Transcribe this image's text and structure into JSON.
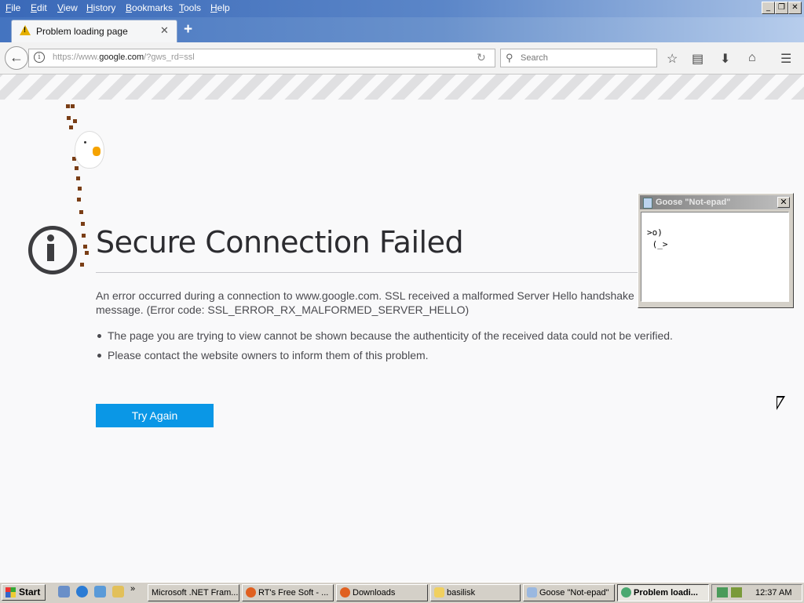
{
  "menu": {
    "items": [
      {
        "key": "F",
        "rest": "ile"
      },
      {
        "key": "E",
        "rest": "dit"
      },
      {
        "key": "V",
        "rest": "iew"
      },
      {
        "key": "H",
        "rest": "istory"
      },
      {
        "key": "B",
        "rest": "ookmarks"
      },
      {
        "key": "T",
        "rest": "ools"
      },
      {
        "key": "H",
        "rest": "elp"
      }
    ]
  },
  "tabs": [
    {
      "title": "Problem loading page",
      "icon": "warning-icon"
    }
  ],
  "nav": {
    "url_scheme": "https://www.",
    "url_host": "google.com",
    "url_path": "/?gws_rd=ssl",
    "search_placeholder": "Search"
  },
  "error": {
    "title": "Secure Connection Failed",
    "description": "An error occurred during a connection to www.google.com. SSL received a malformed Server Hello handshake message. (Error code: SSL_ERROR_RX_MALFORMED_SERVER_HELLO)",
    "bullets": [
      "The page you are trying to view cannot be shown because the authenticity of the received data could not be verified.",
      "Please contact the website owners to inform them of this problem."
    ],
    "try_again": "Try Again"
  },
  "goose_window": {
    "title": "Goose \"Not-epad\"",
    "text": ">o)\n (_>"
  },
  "taskbar": {
    "start": "Start",
    "tasks": [
      {
        "label": "Microsoft .NET Fram...",
        "icon": "app-icon",
        "active": false
      },
      {
        "label": "RT's Free Soft - ...",
        "icon": "firefox-icon",
        "active": false
      },
      {
        "label": "Downloads",
        "icon": "firefox-icon",
        "active": false
      },
      {
        "label": "basilisk",
        "icon": "folder-icon",
        "active": false
      },
      {
        "label": "Goose \"Not-epad\"",
        "icon": "notepad-icon",
        "active": false
      },
      {
        "label": "Problem loadi...",
        "icon": "basilisk-icon",
        "active": true
      }
    ],
    "clock": "12:37 AM"
  }
}
